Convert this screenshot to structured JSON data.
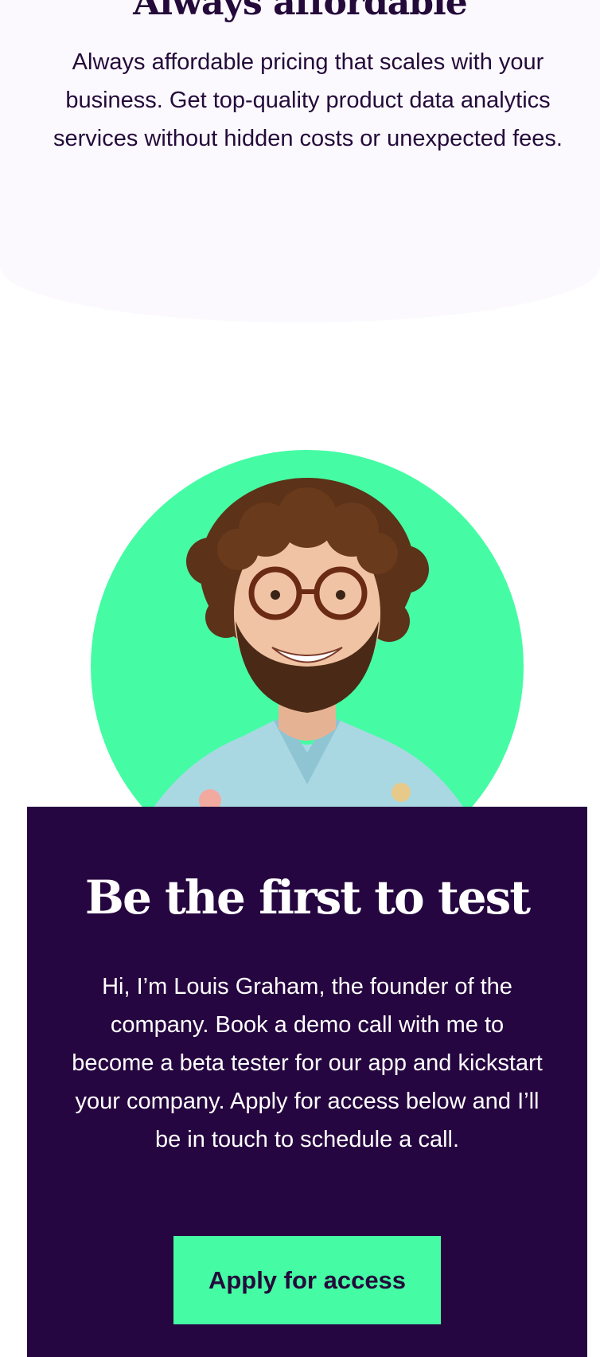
{
  "pricing": {
    "heading": "Always affordable",
    "description": "Always affordable pricing that scales with your business. Get top-quality product data analytics services without hidden costs or unexpected fees."
  },
  "founder": {
    "photo_icon": "founder-portrait",
    "circle_color": "#45fca4"
  },
  "cta": {
    "title": "Be the first to test",
    "body": "Hi, I’m Louis Graham, the founder of the company. Book a demo call with me to become a beta tester for our app and kickstart your company. Apply for access below and I’ll be in touch to schedule a call.",
    "button_label": "Apply for access",
    "background_color": "#260640",
    "accent_color": "#45fca4"
  }
}
